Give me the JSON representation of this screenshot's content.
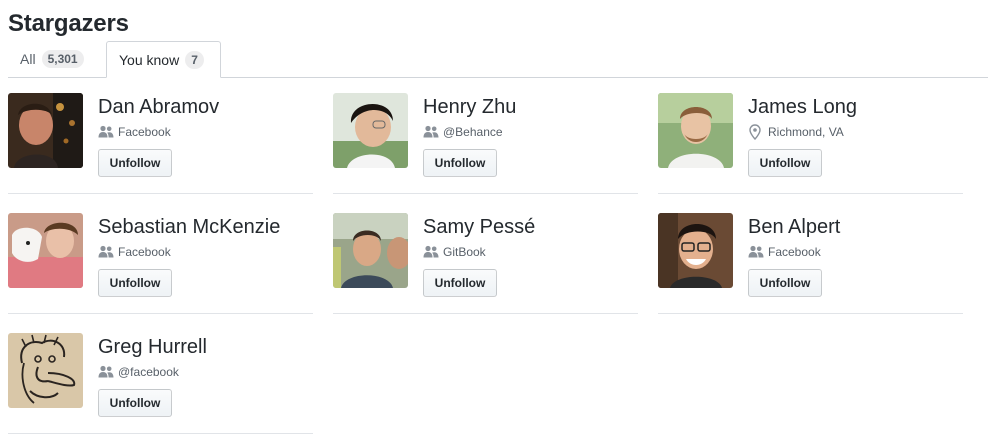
{
  "header": {
    "title": "Stargazers"
  },
  "tabs": [
    {
      "label": "All",
      "count": "5,301",
      "selected": false
    },
    {
      "label": "You know",
      "count": "7",
      "selected": true
    }
  ],
  "people": [
    {
      "name": "Dan Abramov",
      "meta": "Facebook",
      "meta_icon": "organization-icon",
      "button": "Unfollow"
    },
    {
      "name": "Henry Zhu",
      "meta": "@Behance",
      "meta_icon": "organization-icon",
      "button": "Unfollow"
    },
    {
      "name": "James Long",
      "meta": "Richmond, VA",
      "meta_icon": "location-icon",
      "button": "Unfollow"
    },
    {
      "name": "Sebastian McKenzie",
      "meta": "Facebook",
      "meta_icon": "organization-icon",
      "button": "Unfollow"
    },
    {
      "name": "Samy Pessé",
      "meta": "GitBook",
      "meta_icon": "organization-icon",
      "button": "Unfollow"
    },
    {
      "name": "Ben Alpert",
      "meta": "Facebook",
      "meta_icon": "organization-icon",
      "button": "Unfollow"
    },
    {
      "name": "Greg Hurrell",
      "meta": "@facebook",
      "meta_icon": "organization-icon",
      "button": "Unfollow"
    }
  ],
  "colors": {
    "text": "#24292e",
    "muted": "#586069",
    "border": "#e1e4e8"
  }
}
